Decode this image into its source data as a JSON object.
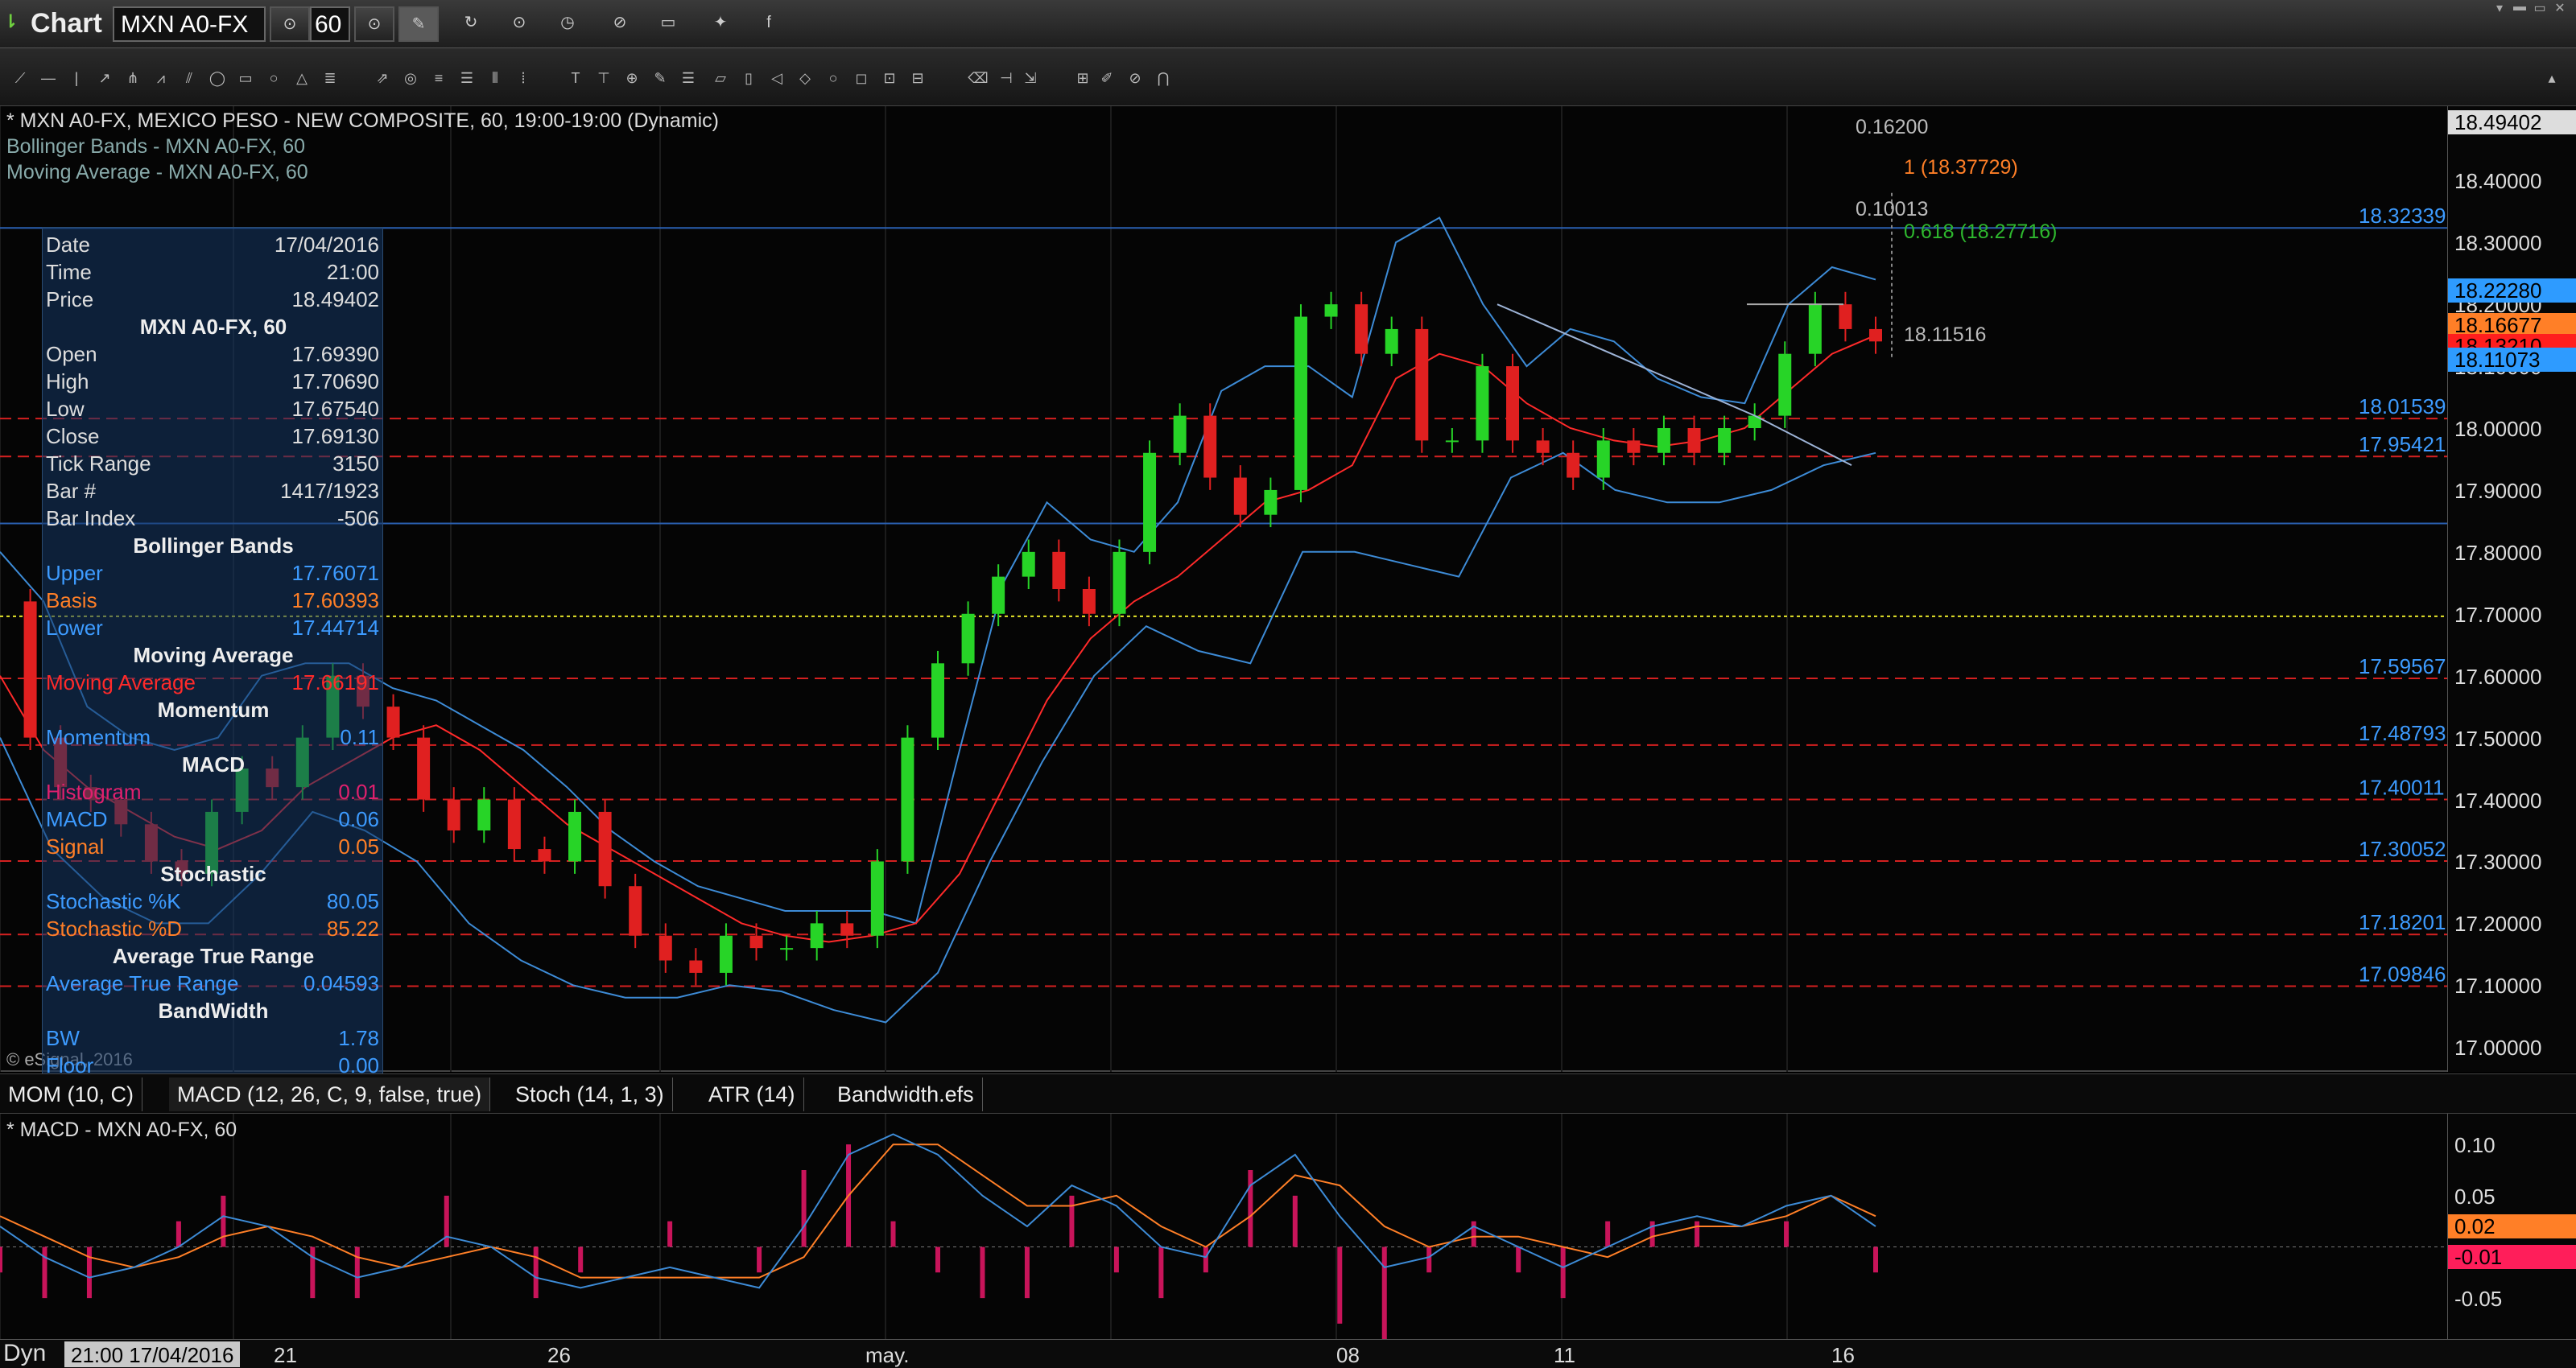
{
  "app": {
    "title": "Chart",
    "symbol": "MXN A0-FX",
    "symbol_suffix": "·",
    "interval": "60",
    "copyright": "© eSignal, 2016"
  },
  "main_pane": {
    "title_line": "* MXN A0-FX, MEXICO PESO - NEW COMPOSITE, 60, 19:00-19:00 (Dynamic)",
    "study_1": "Bollinger Bands - MXN A0-FX, 60",
    "study_2": "Moving Average - MXN A0-FX, 60"
  },
  "data_window": {
    "date_label": "Date",
    "date_value": "17/04/2016",
    "time_label": "Time",
    "time_value": "21:00",
    "price_label": "Price",
    "price_value": "18.49402",
    "symbol_head": "MXN A0-FX, 60",
    "ohlc": [
      {
        "label": "Open",
        "value": "17.69390"
      },
      {
        "label": "High",
        "value": "17.70690"
      },
      {
        "label": "Low",
        "value": "17.67540"
      },
      {
        "label": "Close",
        "value": "17.69130"
      },
      {
        "label": "Tick Range",
        "value": "3150"
      },
      {
        "label": "Bar #",
        "value": "1417/1923"
      },
      {
        "label": "Bar Index",
        "value": "-506"
      }
    ],
    "bb_head": "Bollinger Bands",
    "bb": [
      {
        "label": "Upper",
        "value": "17.76071",
        "color": "#3d9bff"
      },
      {
        "label": "Basis",
        "value": "17.60393",
        "color": "#ff7f27"
      },
      {
        "label": "Lower",
        "value": "17.44714",
        "color": "#3d9bff"
      }
    ],
    "ma_head": "Moving Average",
    "ma": {
      "label": "Moving Average",
      "value": "17.66191",
      "color": "#ff2a2a"
    },
    "mom_head": "Momentum",
    "mom": {
      "label": "Momentum",
      "value": "0.11",
      "color": "#3d9bff"
    },
    "macd_head": "MACD",
    "macd": [
      {
        "label": "Histogram",
        "value": "0.01",
        "color": "#e0206e"
      },
      {
        "label": "MACD",
        "value": "0.06",
        "color": "#3d9bff"
      },
      {
        "label": "Signal",
        "value": "0.05",
        "color": "#ff7f27"
      }
    ],
    "stoch_head": "Stochastic",
    "stoch": [
      {
        "label": "Stochastic %K",
        "value": "80.05",
        "color": "#3d9bff"
      },
      {
        "label": "Stochastic %D",
        "value": "85.22",
        "color": "#ff7f27"
      }
    ],
    "atr_head": "Average True Range",
    "atr": {
      "label": "Average True Range",
      "value": "0.04593",
      "color": "#3d9bff"
    },
    "bw_head": "BandWidth",
    "bw": [
      {
        "label": "BW",
        "value": "1.78",
        "color": "#3d9bff"
      },
      {
        "label": "Floor",
        "value": "0.00",
        "color": "#3d9bff"
      }
    ]
  },
  "annotations": {
    "fib_top": "0.16200",
    "fib_1": "1 (18.37729)",
    "fib_mid": "0.10013",
    "fib_618": "0.618 (18.27716)",
    "last_label": "18.11516"
  },
  "horizontal_levels": [
    {
      "price": 18.32339,
      "label": "18.32339",
      "style": "solid",
      "color": "#2a5fb0"
    },
    {
      "price": 18.01539,
      "label": "18.01539",
      "style": "dashed",
      "color": "#d42020"
    },
    {
      "price": 17.95421,
      "label": "17.95421",
      "style": "dashed",
      "color": "#d42020"
    },
    {
      "price": 17.846,
      "label": "",
      "style": "solid",
      "color": "#2a5fb0"
    },
    {
      "price": 17.696,
      "label": "",
      "style": "dotted",
      "color": "#e6e62a"
    },
    {
      "price": 17.59567,
      "label": "17.59567",
      "style": "dashed",
      "color": "#d42020"
    },
    {
      "price": 17.48793,
      "label": "17.48793",
      "style": "dashed",
      "color": "#d42020"
    },
    {
      "price": 17.40011,
      "label": "17.40011",
      "style": "dashed",
      "color": "#d42020"
    },
    {
      "price": 17.30052,
      "label": "17.30052",
      "style": "dashed",
      "color": "#d42020"
    },
    {
      "price": 17.18201,
      "label": "17.18201",
      "style": "dashed",
      "color": "#d42020"
    },
    {
      "price": 17.09846,
      "label": "17.09846",
      "style": "dashed",
      "color": "#d42020"
    }
  ],
  "price_axis": {
    "ticks": [
      "18.40000",
      "18.30000",
      "18.20000",
      "18.10000",
      "18.00000",
      "17.90000",
      "17.80000",
      "17.70000",
      "17.60000",
      "17.50000",
      "17.40000",
      "17.30000",
      "17.20000",
      "17.10000",
      "17.00000"
    ],
    "tags": [
      {
        "text": "18.49402",
        "color": "#dddddd",
        "price": 18.49402
      },
      {
        "text": "18.22280",
        "color": "#2e9bff",
        "price": 18.2228
      },
      {
        "text": "18.16677",
        "color": "#ff7f27",
        "price": 18.16677
      },
      {
        "text": "18.13210",
        "color": "#ff1e1e",
        "price": 18.1321
      },
      {
        "text": "18.11073",
        "color": "#2e9bff",
        "price": 18.11073
      }
    ]
  },
  "indicator_tabs": [
    "MOM (10, C)",
    "MACD (12, 26, C, 9, false, true)",
    "Stoch (14, 1, 3)",
    "ATR (14)",
    "Bandwidth.efs"
  ],
  "macd_pane": {
    "title": "* MACD - MXN A0-FX, 60",
    "ticks": [
      "0.10",
      "0.05",
      "-0.05"
    ],
    "tags": [
      {
        "text": "0.02",
        "color": "#ff7f27",
        "value": 0.02
      },
      {
        "text": "-0.01",
        "color": "#ff1e5a",
        "value": -0.01
      }
    ]
  },
  "time_axis": {
    "cursor_prefix": "Dyn",
    "cursor_label": "21:00 17/04/2016",
    "labels": [
      "21",
      "26",
      "may.",
      "08",
      "11",
      "16"
    ]
  },
  "chart_data": {
    "type": "line",
    "title": "* MXN A0-FX, MEXICO PESO - NEW COMPOSITE, 60, 19:00-19:00 (Dynamic)",
    "xlabel": "",
    "ylabel": "",
    "x_labels": [
      "21",
      "26",
      "may.",
      "08",
      "11",
      "16"
    ],
    "ylim": [
      16.96,
      18.52
    ],
    "series": [
      {
        "name": "MXN A0-FX",
        "color": "#dddddd",
        "values": [
          17.72,
          17.5,
          17.42,
          17.4,
          17.36,
          17.3,
          17.28,
          17.38,
          17.45,
          17.42,
          17.5,
          17.6,
          17.55,
          17.5,
          17.4,
          17.35,
          17.4,
          17.32,
          17.3,
          17.38,
          17.26,
          17.18,
          17.14,
          17.12,
          17.18,
          17.16,
          17.16,
          17.2,
          17.18,
          17.3,
          17.5,
          17.62,
          17.7,
          17.76,
          17.8,
          17.74,
          17.7,
          17.8,
          17.96,
          18.02,
          17.92,
          17.86,
          17.9,
          18.18,
          18.2,
          18.12,
          18.16,
          17.98,
          17.98,
          18.1,
          17.98,
          17.96,
          17.92,
          17.98,
          17.96,
          18.0,
          17.96,
          18.0,
          18.02,
          18.12,
          18.2,
          18.16,
          18.14
        ]
      },
      {
        "name": "Bollinger Upper",
        "color": "#3d8bd6",
        "values": [
          17.8,
          17.72,
          17.55,
          17.5,
          17.48,
          17.5,
          17.6,
          17.62,
          17.62,
          17.58,
          17.56,
          17.52,
          17.48,
          17.42,
          17.35,
          17.3,
          17.26,
          17.24,
          17.22,
          17.22,
          17.22,
          17.2,
          17.48,
          17.75,
          17.88,
          17.82,
          17.8,
          17.88,
          18.06,
          18.1,
          18.1,
          18.05,
          18.3,
          18.34,
          18.2,
          18.1,
          18.16,
          18.14,
          18.08,
          18.05,
          18.04,
          18.2,
          18.26,
          18.24
        ]
      },
      {
        "name": "Bollinger Lower",
        "color": "#3d8bd6",
        "values": [
          17.5,
          17.32,
          17.24,
          17.2,
          17.2,
          17.28,
          17.38,
          17.35,
          17.3,
          17.2,
          17.14,
          17.1,
          17.08,
          17.08,
          17.1,
          17.09,
          17.06,
          17.04,
          17.12,
          17.3,
          17.46,
          17.6,
          17.68,
          17.64,
          17.62,
          17.8,
          17.8,
          17.78,
          17.76,
          17.92,
          17.96,
          17.9,
          17.88,
          17.88,
          17.9,
          17.94,
          17.96
        ]
      },
      {
        "name": "Moving Average",
        "color": "#ff2a2a",
        "values": [
          17.6,
          17.48,
          17.42,
          17.38,
          17.34,
          17.32,
          17.35,
          17.42,
          17.46,
          17.5,
          17.52,
          17.48,
          17.42,
          17.36,
          17.32,
          17.28,
          17.24,
          17.2,
          17.18,
          17.17,
          17.18,
          17.2,
          17.28,
          17.42,
          17.56,
          17.66,
          17.72,
          17.76,
          17.82,
          17.88,
          17.9,
          17.94,
          18.08,
          18.12,
          18.1,
          18.04,
          18.0,
          17.98,
          17.97,
          17.98,
          18.0,
          18.06,
          18.12,
          18.15
        ]
      }
    ],
    "macd": {
      "ylim": [
        -0.09,
        0.13
      ],
      "macd_line": [
        0.02,
        -0.01,
        -0.03,
        -0.02,
        0.0,
        0.03,
        0.02,
        -0.01,
        -0.03,
        -0.02,
        0.01,
        0.0,
        -0.03,
        -0.04,
        -0.03,
        -0.02,
        -0.03,
        -0.04,
        0.02,
        0.09,
        0.11,
        0.09,
        0.05,
        0.02,
        0.06,
        0.04,
        0.0,
        -0.01,
        0.06,
        0.09,
        0.03,
        -0.02,
        -0.01,
        0.02,
        0.0,
        -0.02,
        0.0,
        0.02,
        0.03,
        0.02,
        0.04,
        0.05,
        0.02
      ],
      "signal_line": [
        0.03,
        0.01,
        -0.01,
        -0.02,
        -0.01,
        0.01,
        0.02,
        0.01,
        -0.01,
        -0.02,
        -0.01,
        0.0,
        -0.01,
        -0.03,
        -0.03,
        -0.03,
        -0.03,
        -0.03,
        -0.01,
        0.05,
        0.1,
        0.1,
        0.07,
        0.04,
        0.04,
        0.05,
        0.02,
        0.0,
        0.03,
        0.07,
        0.06,
        0.02,
        0.0,
        0.01,
        0.01,
        0.0,
        -0.01,
        0.01,
        0.02,
        0.02,
        0.03,
        0.05,
        0.03
      ]
    }
  }
}
